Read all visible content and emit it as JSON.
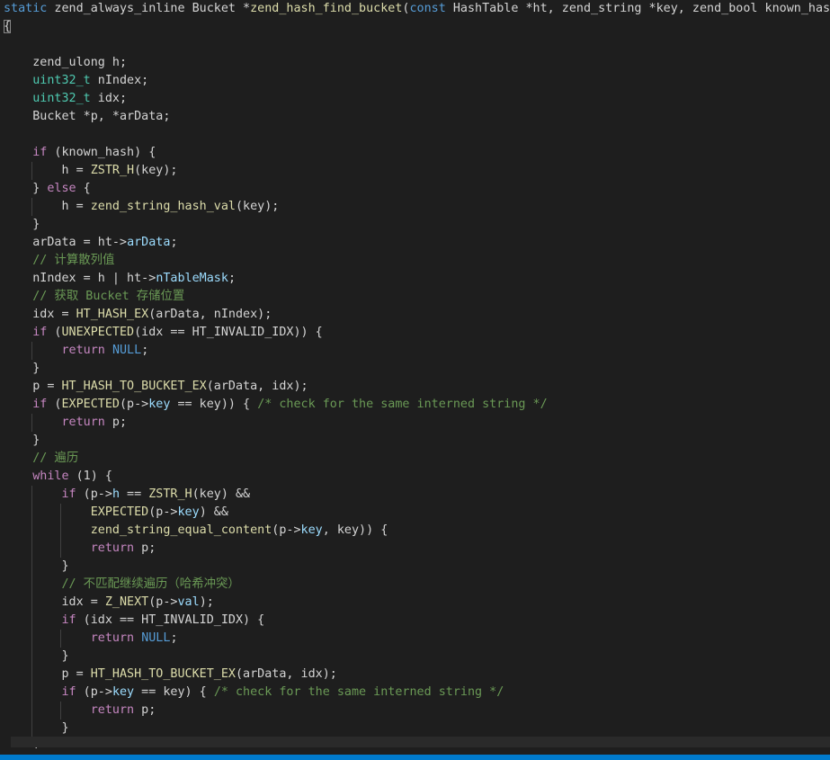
{
  "editor": {
    "lines": [
      [
        {
          "t": "static",
          "c": "kw"
        },
        {
          "t": " zend_always_inline Bucket ",
          "c": "op"
        },
        {
          "t": "*",
          "c": "op"
        },
        {
          "t": "zend_hash_find_bucket",
          "c": "fn"
        },
        {
          "t": "(",
          "c": "op"
        },
        {
          "t": "const",
          "c": "kw"
        },
        {
          "t": " HashTable *ht, zend_string *key, zend_bool known_hash)",
          "c": "op"
        }
      ],
      [
        {
          "t": "{",
          "c": "brace-hl"
        }
      ],
      [],
      [
        {
          "t": "    zend_ulong h;",
          "c": "op"
        }
      ],
      [
        {
          "t": "    ",
          "c": "op"
        },
        {
          "t": "uint32_t",
          "c": "type"
        },
        {
          "t": " nIndex;",
          "c": "op"
        }
      ],
      [
        {
          "t": "    ",
          "c": "op"
        },
        {
          "t": "uint32_t",
          "c": "type"
        },
        {
          "t": " idx;",
          "c": "op"
        }
      ],
      [
        {
          "t": "    Bucket *p, *arData;",
          "c": "op"
        }
      ],
      [],
      [
        {
          "t": "    ",
          "c": "op"
        },
        {
          "t": "if",
          "c": "ctl"
        },
        {
          "t": " (known_hash) {",
          "c": "op"
        }
      ],
      [
        {
          "t": "        h = ",
          "c": "op"
        },
        {
          "t": "ZSTR_H",
          "c": "fn"
        },
        {
          "t": "(key);",
          "c": "op"
        }
      ],
      [
        {
          "t": "    } ",
          "c": "op"
        },
        {
          "t": "else",
          "c": "ctl"
        },
        {
          "t": " {",
          "c": "op"
        }
      ],
      [
        {
          "t": "        h = ",
          "c": "op"
        },
        {
          "t": "zend_string_hash_val",
          "c": "fn"
        },
        {
          "t": "(key);",
          "c": "op"
        }
      ],
      [
        {
          "t": "    }",
          "c": "op"
        }
      ],
      [
        {
          "t": "    arData = ht->",
          "c": "op"
        },
        {
          "t": "arData",
          "c": "prop"
        },
        {
          "t": ";",
          "c": "op"
        }
      ],
      [
        {
          "t": "    ",
          "c": "op"
        },
        {
          "t": "// 计算散列值",
          "c": "cmt"
        }
      ],
      [
        {
          "t": "    nIndex = h | ht->",
          "c": "op"
        },
        {
          "t": "nTableMask",
          "c": "prop"
        },
        {
          "t": ";",
          "c": "op"
        }
      ],
      [
        {
          "t": "    ",
          "c": "op"
        },
        {
          "t": "// 获取 Bucket 存储位置",
          "c": "cmt"
        }
      ],
      [
        {
          "t": "    idx = ",
          "c": "op"
        },
        {
          "t": "HT_HASH_EX",
          "c": "fn"
        },
        {
          "t": "(arData, nIndex);",
          "c": "op"
        }
      ],
      [
        {
          "t": "    ",
          "c": "op"
        },
        {
          "t": "if",
          "c": "ctl"
        },
        {
          "t": " (",
          "c": "op"
        },
        {
          "t": "UNEXPECTED",
          "c": "fn"
        },
        {
          "t": "(idx == HT_INVALID_IDX)) {",
          "c": "op"
        }
      ],
      [
        {
          "t": "        ",
          "c": "op"
        },
        {
          "t": "return",
          "c": "ctl"
        },
        {
          "t": " ",
          "c": "op"
        },
        {
          "t": "NULL",
          "c": "kw"
        },
        {
          "t": ";",
          "c": "op"
        }
      ],
      [
        {
          "t": "    }",
          "c": "op"
        }
      ],
      [
        {
          "t": "    p = ",
          "c": "op"
        },
        {
          "t": "HT_HASH_TO_BUCKET_EX",
          "c": "fn"
        },
        {
          "t": "(arData, idx);",
          "c": "op"
        }
      ],
      [
        {
          "t": "    ",
          "c": "op"
        },
        {
          "t": "if",
          "c": "ctl"
        },
        {
          "t": " (",
          "c": "op"
        },
        {
          "t": "EXPECTED",
          "c": "fn"
        },
        {
          "t": "(p->",
          "c": "op"
        },
        {
          "t": "key",
          "c": "prop"
        },
        {
          "t": " == key)) { ",
          "c": "op"
        },
        {
          "t": "/* check for the same interned string */",
          "c": "cmt"
        }
      ],
      [
        {
          "t": "        ",
          "c": "op"
        },
        {
          "t": "return",
          "c": "ctl"
        },
        {
          "t": " p;",
          "c": "op"
        }
      ],
      [
        {
          "t": "    }",
          "c": "op"
        }
      ],
      [
        {
          "t": "    ",
          "c": "op"
        },
        {
          "t": "// 遍历",
          "c": "cmt"
        }
      ],
      [
        {
          "t": "    ",
          "c": "op"
        },
        {
          "t": "while",
          "c": "ctl"
        },
        {
          "t": " (1) {",
          "c": "op"
        }
      ],
      [
        {
          "t": "        ",
          "c": "op"
        },
        {
          "t": "if",
          "c": "ctl"
        },
        {
          "t": " (p->",
          "c": "op"
        },
        {
          "t": "h",
          "c": "prop"
        },
        {
          "t": " == ",
          "c": "op"
        },
        {
          "t": "ZSTR_H",
          "c": "fn"
        },
        {
          "t": "(key) &&",
          "c": "op"
        }
      ],
      [
        {
          "t": "            ",
          "c": "op"
        },
        {
          "t": "EXPECTED",
          "c": "fn"
        },
        {
          "t": "(p->",
          "c": "op"
        },
        {
          "t": "key",
          "c": "prop"
        },
        {
          "t": ") &&",
          "c": "op"
        }
      ],
      [
        {
          "t": "            ",
          "c": "op"
        },
        {
          "t": "zend_string_equal_content",
          "c": "fn"
        },
        {
          "t": "(p->",
          "c": "op"
        },
        {
          "t": "key",
          "c": "prop"
        },
        {
          "t": ", key)) {",
          "c": "op"
        }
      ],
      [
        {
          "t": "            ",
          "c": "op"
        },
        {
          "t": "return",
          "c": "ctl"
        },
        {
          "t": " p;",
          "c": "op"
        }
      ],
      [
        {
          "t": "        }",
          "c": "op"
        }
      ],
      [
        {
          "t": "        ",
          "c": "op"
        },
        {
          "t": "// 不匹配继续遍历（哈希冲突）",
          "c": "cmt"
        }
      ],
      [
        {
          "t": "        idx = ",
          "c": "op"
        },
        {
          "t": "Z_NEXT",
          "c": "fn"
        },
        {
          "t": "(p->",
          "c": "op"
        },
        {
          "t": "val",
          "c": "prop"
        },
        {
          "t": ");",
          "c": "op"
        }
      ],
      [
        {
          "t": "        ",
          "c": "op"
        },
        {
          "t": "if",
          "c": "ctl"
        },
        {
          "t": " (idx == HT_INVALID_IDX) {",
          "c": "op"
        }
      ],
      [
        {
          "t": "            ",
          "c": "op"
        },
        {
          "t": "return",
          "c": "ctl"
        },
        {
          "t": " ",
          "c": "op"
        },
        {
          "t": "NULL",
          "c": "kw"
        },
        {
          "t": ";",
          "c": "op"
        }
      ],
      [
        {
          "t": "        }",
          "c": "op"
        }
      ],
      [
        {
          "t": "        p = ",
          "c": "op"
        },
        {
          "t": "HT_HASH_TO_BUCKET_EX",
          "c": "fn"
        },
        {
          "t": "(arData, idx);",
          "c": "op"
        }
      ],
      [
        {
          "t": "        ",
          "c": "op"
        },
        {
          "t": "if",
          "c": "ctl"
        },
        {
          "t": " (p->",
          "c": "op"
        },
        {
          "t": "key",
          "c": "prop"
        },
        {
          "t": " == key) { ",
          "c": "op"
        },
        {
          "t": "/* check for the same interned string */",
          "c": "cmt"
        }
      ],
      [
        {
          "t": "            ",
          "c": "op"
        },
        {
          "t": "return",
          "c": "ctl"
        },
        {
          "t": " p;",
          "c": "op"
        }
      ],
      [
        {
          "t": "        }",
          "c": "op"
        }
      ],
      [
        {
          "t": "    }",
          "c": "op"
        }
      ],
      [],
      [
        {
          "t": "}",
          "c": "brace-hl"
        }
      ]
    ]
  },
  "colors": {
    "background": "#1e1e1e",
    "keyword": "#569cd6",
    "control": "#c586c0",
    "type": "#4ec9b0",
    "function": "#dcdcaa",
    "property": "#9cdcfe",
    "comment": "#6a9955",
    "text": "#d4d4d4",
    "status_bar": "#007acc"
  }
}
